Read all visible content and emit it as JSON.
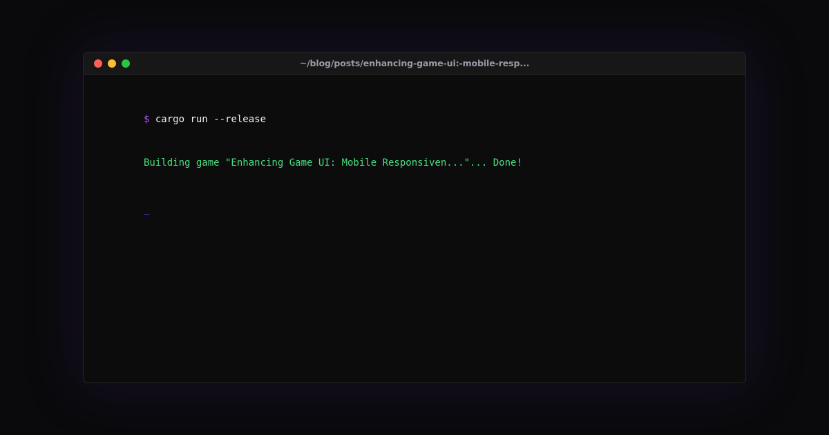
{
  "window": {
    "title": "~/blog/posts/enhancing-game-ui:-mobile-resp...",
    "controls": {
      "close_color": "#ff5f57",
      "minimize_color": "#febc2e",
      "maximize_color": "#28c840"
    }
  },
  "terminal": {
    "prompt": "$",
    "command": "cargo run --release",
    "output": "Building game \"Enhancing Game UI: Mobile Responsiven...\"... Done!",
    "output_color": "#4ade80",
    "prompt_color": "#a855f7",
    "cursor": "_",
    "cursor_color": "#7c3aed"
  }
}
